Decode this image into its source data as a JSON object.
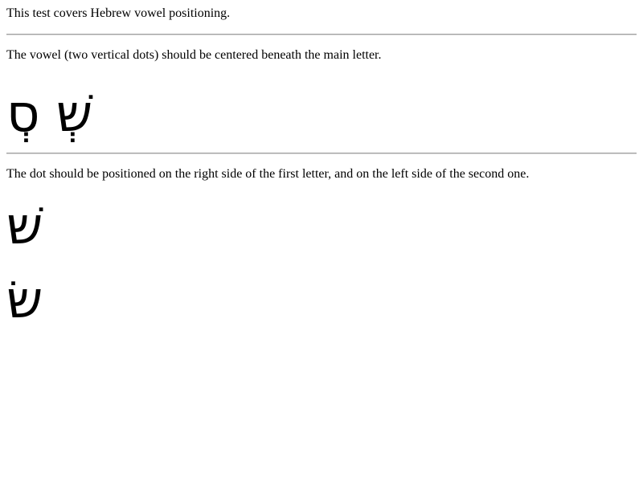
{
  "intro_text": "This test covers Hebrew vowel positioning.",
  "vowel_section": {
    "instruction": "The vowel (two vertical dots) should be centered beneath the main letter.",
    "sample": "שְׁ סְ"
  },
  "dot_section": {
    "instruction": "The dot should be positioned on the right side of the first letter, and on the left side of the second one.",
    "samples": [
      "שׁ",
      "שׂ"
    ]
  }
}
